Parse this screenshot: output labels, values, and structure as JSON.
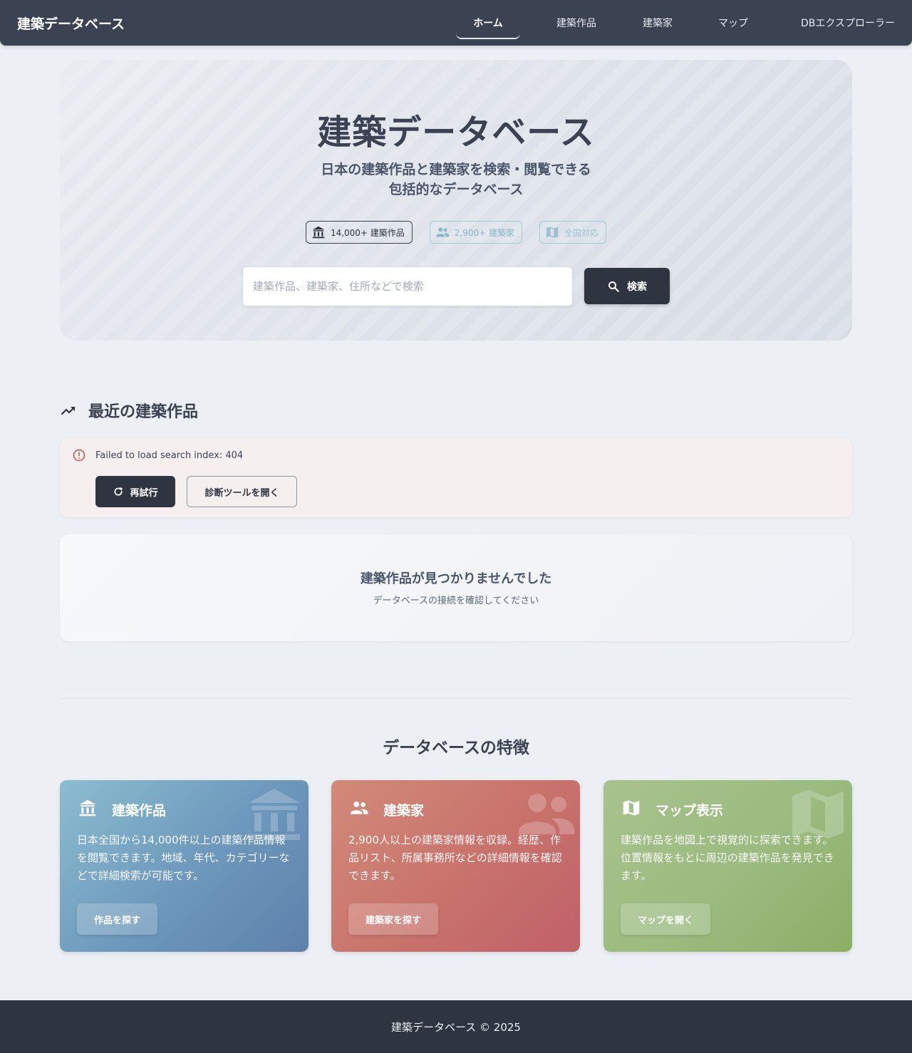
{
  "nav": {
    "brand": "建築データベース",
    "links": [
      {
        "label": "ホーム",
        "active": true
      },
      {
        "label": "建築作品"
      },
      {
        "label": "建築家"
      },
      {
        "label": "マップ"
      },
      {
        "label": "DBエクスプローラー"
      }
    ]
  },
  "hero": {
    "title": "建築データベース",
    "subtitle_line1": "日本の建築作品と建築家を検索・閲覧できる",
    "subtitle_line2": "包括的なデータベース",
    "badges": [
      {
        "icon": "building-icon",
        "label": "14,000+ 建築作品"
      },
      {
        "icon": "people-icon",
        "label": "2,900+ 建築家"
      },
      {
        "icon": "map-icon",
        "label": "全国対応"
      }
    ],
    "search": {
      "placeholder": "建築作品、建築家、住所などで検索",
      "value": "",
      "button_label": "検索"
    }
  },
  "recent": {
    "title": "最近の建築作品",
    "error": {
      "message": "Failed to load search index: 404",
      "retry_label": "再試行",
      "diagnostics_label": "診断ツールを開く"
    },
    "empty": {
      "title": "建築作品が見つかりませんでした",
      "subtitle": "データベースの接続を確認してください"
    }
  },
  "features": {
    "title": "データベースの特徴",
    "cards": [
      {
        "icon": "building-icon",
        "title": "建築作品",
        "description": "日本全国から14,000件以上の建築作品情報を閲覧できます。地域、年代、カテゴリーなどで詳細検索が可能です。",
        "button_label": "作品を探す",
        "color": "#5e81ac"
      },
      {
        "icon": "people-icon",
        "title": "建築家",
        "description": "2,900人以上の建築家情報を収録。経歴、作品リスト、所属事務所などの詳細情報を確認できます。",
        "button_label": "建築家を探す",
        "color": "#bf616a"
      },
      {
        "icon": "map-icon",
        "title": "マップ表示",
        "description": "建築作品を地図上で視覚的に探索できます。位置情報をもとに周辺の建築作品を発見できます。",
        "button_label": "マップを開く",
        "color": "#8cae66"
      }
    ]
  },
  "footer": {
    "text": "建築データベース © 2025"
  },
  "colors": {
    "nav_bg": "#3b4252",
    "primary": "#2e3440",
    "page_bg": "#eceff4",
    "error_bg": "#f6efef",
    "error_accent": "#bf616a"
  }
}
